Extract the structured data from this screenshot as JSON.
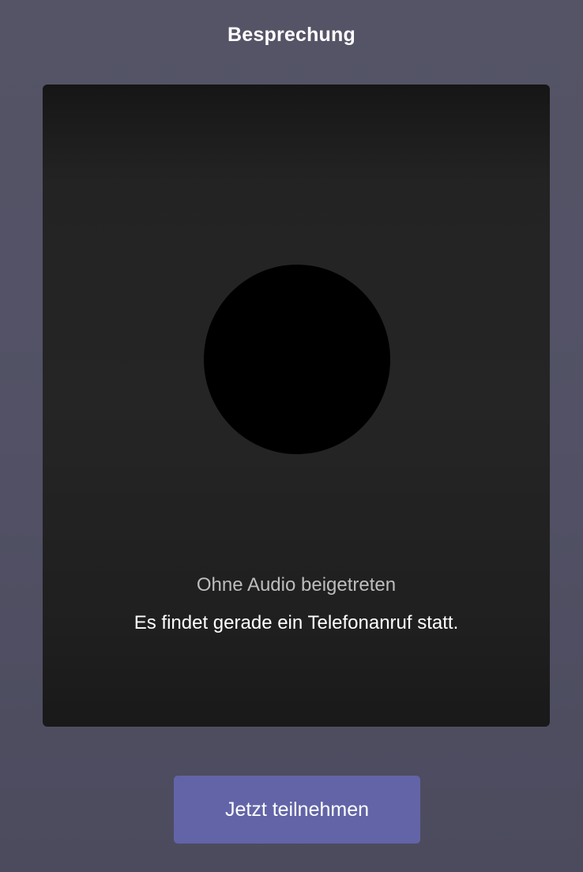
{
  "header": {
    "title": "Besprechung"
  },
  "preview": {
    "status_muted": "Ohne Audio beigetreten",
    "status_info": "Es findet gerade ein Telefonanruf statt."
  },
  "footer": {
    "join_label": "Jetzt teilnehmen"
  },
  "colors": {
    "background": "#525165",
    "preview_background": "#232323",
    "avatar": "#000000",
    "button": "#6264a7",
    "text_primary": "#ffffff",
    "text_secondary": "#bdbdbd"
  }
}
